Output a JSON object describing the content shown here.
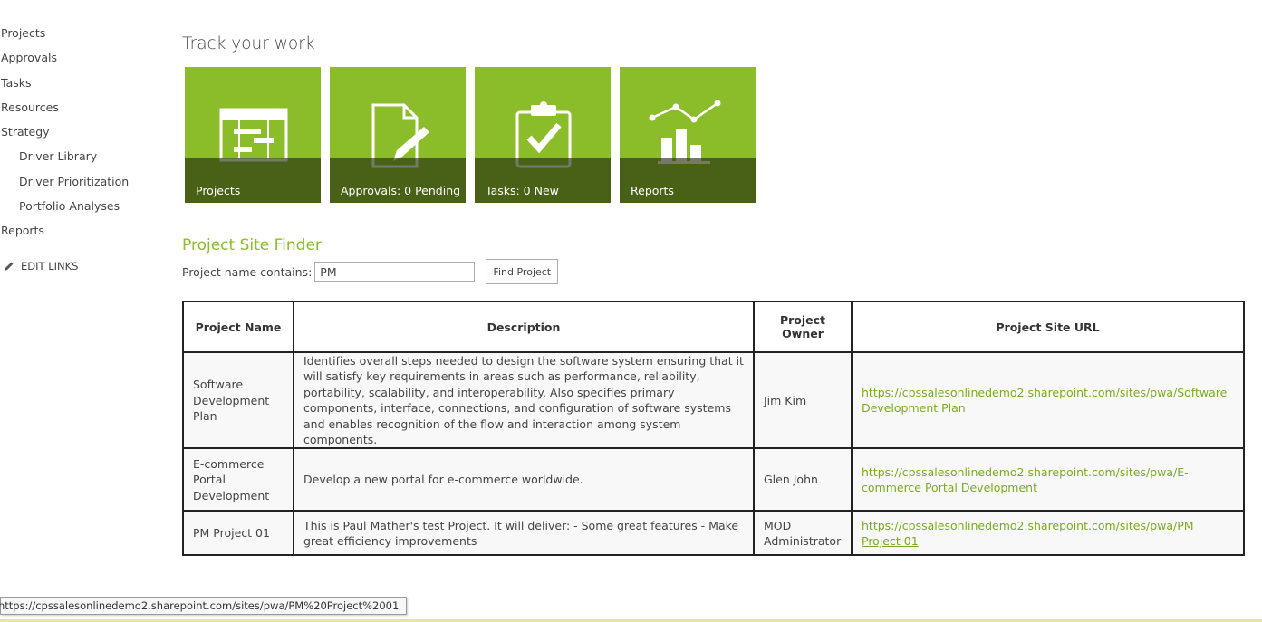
{
  "nav": {
    "items": [
      {
        "label": "Projects",
        "sub": false
      },
      {
        "label": "Approvals",
        "sub": false
      },
      {
        "label": "Tasks",
        "sub": false
      },
      {
        "label": "Resources",
        "sub": false
      },
      {
        "label": "Strategy",
        "sub": false
      },
      {
        "label": "Driver Library",
        "sub": true
      },
      {
        "label": "Driver Prioritization",
        "sub": true
      },
      {
        "label": "Portfolio Analyses",
        "sub": true
      },
      {
        "label": "Reports",
        "sub": false
      }
    ],
    "edit_links": "EDIT LINKS",
    "edit_icon": "pencil-icon"
  },
  "track": {
    "title": "Track your work",
    "tiles": [
      {
        "label": "Projects",
        "icon": "gantt-icon"
      },
      {
        "label": "Approvals: 0 Pending",
        "icon": "document-edit-icon"
      },
      {
        "label": "Tasks: 0 New",
        "icon": "clipboard-check-icon"
      },
      {
        "label": "Reports",
        "icon": "chart-icon"
      }
    ],
    "tile_color": "#8bbd2a"
  },
  "finder": {
    "title": "Project Site Finder",
    "label": "Project name contains:",
    "value": "PM",
    "button": "Find Project"
  },
  "table": {
    "headers": [
      "Project Name",
      "Description",
      "Project Owner",
      "Project Site URL"
    ],
    "rows": [
      {
        "name": "Software Development Plan",
        "description": "Identifies overall steps needed to design the software system ensuring that it will satisfy key requirements in areas such as performance, reliability, portability, scalability, and interoperability. Also specifies primary components, interface, connections, and configuration of software systems and enables recognition of the flow and interaction among system components.",
        "owner": "Jim Kim",
        "url": "https://cpssalesonlinedemo2.sharepoint.com/sites/pwa/Software Development Plan"
      },
      {
        "name": "E-commerce Portal Development",
        "description": "Develop a new portal for e-commerce worldwide.",
        "owner": "Glen John",
        "url": "https://cpssalesonlinedemo2.sharepoint.com/sites/pwa/E-commerce Portal Development"
      },
      {
        "name": "PM Project 01",
        "description": "This is Paul Mather's test Project. It will deliver: - Some great features - Make great efficiency improvements",
        "owner": "MOD Administrator",
        "url": "https://cpssalesonlinedemo2.sharepoint.com/sites/pwa/PM Project 01"
      }
    ],
    "link_color": "#7aab1e"
  },
  "status": {
    "url": "https://cpssalesonlinedemo2.sharepoint.com/sites/pwa/PM%20Project%2001"
  }
}
